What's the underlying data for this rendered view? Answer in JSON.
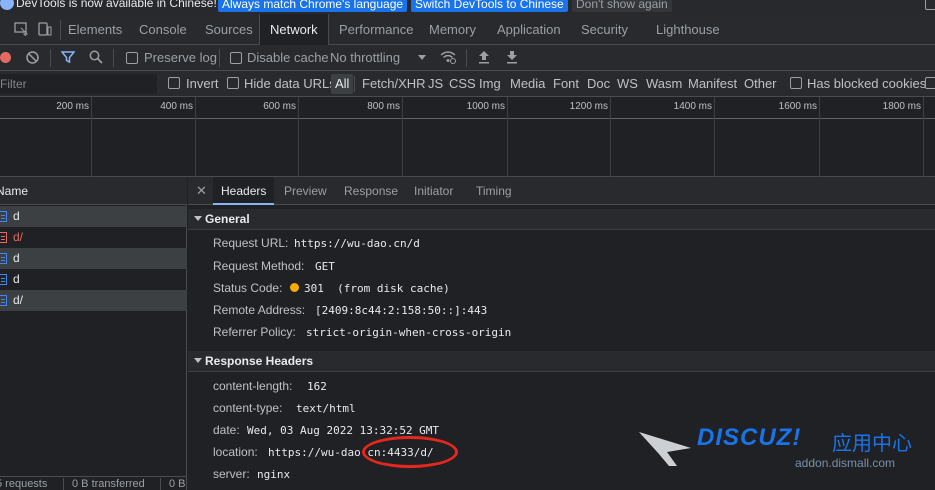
{
  "infobar": {
    "message": "DevTools is now available in Chinese!",
    "btn_match": "Always match Chrome's language",
    "btn_switch": "Switch DevTools to Chinese",
    "btn_dont_show": "Don't show again"
  },
  "main_tabs": [
    "Elements",
    "Console",
    "Sources",
    "Network",
    "Performance",
    "Memory",
    "Application",
    "Security",
    "Lighthouse"
  ],
  "toolbar": {
    "preserve_log": "Preserve log",
    "disable_cache": "Disable cache",
    "throttling": "No throttling"
  },
  "filter": {
    "placeholder": "Filter",
    "invert": "Invert",
    "hide_data_urls": "Hide data URLs",
    "types": [
      "All",
      "Fetch/XHR",
      "JS",
      "CSS",
      "Img",
      "Media",
      "Font",
      "Doc",
      "WS",
      "Wasm",
      "Manifest",
      "Other"
    ],
    "has_blocked_cookies": "Has blocked cookies"
  },
  "timeline_ticks": [
    "200 ms",
    "400 ms",
    "600 ms",
    "800 ms",
    "1000 ms",
    "1200 ms",
    "1400 ms",
    "1600 ms",
    "1800 ms"
  ],
  "list": {
    "header": "Name",
    "rows": [
      {
        "name": "d",
        "error": false
      },
      {
        "name": "d/",
        "error": true
      },
      {
        "name": "d",
        "error": false
      },
      {
        "name": "d",
        "error": false
      },
      {
        "name": "d/",
        "error": false
      }
    ],
    "status_requests": "5 requests",
    "status_transferred": "0 B transferred",
    "status_resources": "0 B"
  },
  "detail_tabs": [
    "Headers",
    "Preview",
    "Response",
    "Initiator",
    "Timing"
  ],
  "general": {
    "title": "General",
    "request_url_label": "Request URL:",
    "request_url": "https://wu-dao.cn/d",
    "request_method_label": "Request Method:",
    "request_method": "GET",
    "status_code_label": "Status Code:",
    "status_code": "301  (from disk cache)",
    "remote_address_label": "Remote Address:",
    "remote_address": "[2409:8c44:2:158:50::]:443",
    "referrer_policy_label": "Referrer Policy:",
    "referrer_policy": "strict-origin-when-cross-origin"
  },
  "response_headers": {
    "title": "Response Headers",
    "content_length_label": "content-length:",
    "content_length": "162",
    "content_type_label": "content-type:",
    "content_type": "text/html",
    "date_label": "date:",
    "date": "Wed, 03 Aug 2022 13:32:52 GMT",
    "location_label": "location:",
    "location": "https://wu-dao.cn:4433/d/",
    "server_label": "server:",
    "server": "nginx"
  },
  "watermark": {
    "brand": "DISCUZ!",
    "brand_cn": "应用中心",
    "site": "addon.dismall.com"
  },
  "colors": {
    "accent": "#8ab4f8",
    "error": "#e46962",
    "highlight": "#e5281d",
    "brand": "#1a73e8"
  }
}
